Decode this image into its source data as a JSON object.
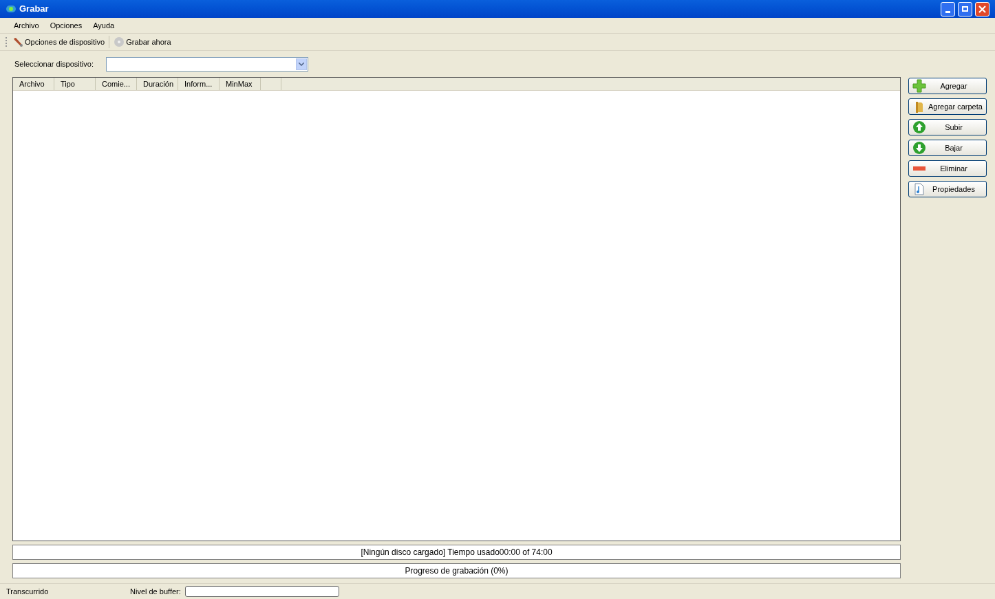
{
  "window": {
    "title": "Grabar"
  },
  "menu": [
    "Archivo",
    "Opciones",
    "Ayuda"
  ],
  "toolbar": [
    {
      "kind": "tools",
      "label": "Opciones de dispositivo"
    },
    {
      "kind": "disc",
      "label": "Grabar ahora"
    }
  ],
  "device": {
    "label": "Seleccionar dispositivo:"
  },
  "table": {
    "columns": [
      "Archivo",
      "Tipo",
      "Comie...",
      "Duración",
      "Inform...",
      "MinMax"
    ]
  },
  "buttons": [
    {
      "kind": "add",
      "label": "Agregar"
    },
    {
      "kind": "folder",
      "label": "Agregar carpeta"
    },
    {
      "kind": "up",
      "label": "Subir"
    },
    {
      "kind": "down",
      "label": "Bajar"
    },
    {
      "kind": "remove",
      "label": "Eliminar"
    },
    {
      "kind": "file",
      "label": "Propiedades"
    }
  ],
  "disc_usage": {
    "text": "[Ningún disco cargado] Tiempo usado00:00 of 74:00",
    "level": 0
  },
  "burn_progress": {
    "text": "Progreso de grabación (0%)",
    "level": 0
  },
  "status_bar": {
    "elapsed": "Transcurrido",
    "buffer_label": "Nivel de buffer:"
  }
}
